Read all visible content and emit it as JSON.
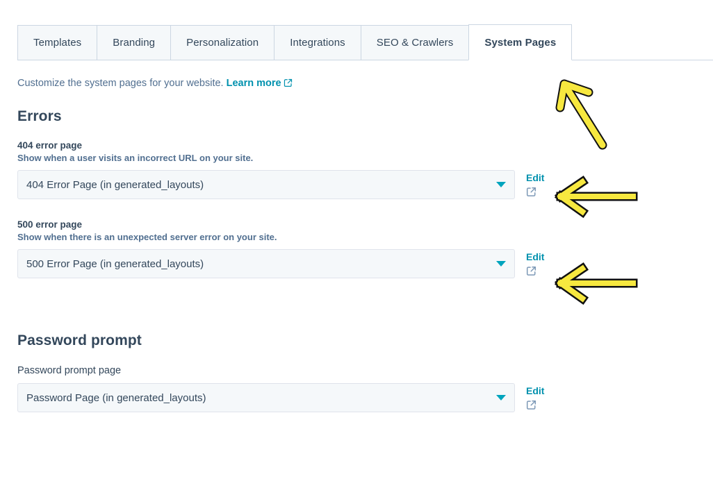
{
  "tabs": [
    {
      "label": "Templates",
      "active": false
    },
    {
      "label": "Branding",
      "active": false
    },
    {
      "label": "Personalization",
      "active": false
    },
    {
      "label": "Integrations",
      "active": false
    },
    {
      "label": "SEO & Crawlers",
      "active": false
    },
    {
      "label": "System Pages",
      "active": true
    }
  ],
  "intro": {
    "text": "Customize the system pages for your website.",
    "link_label": "Learn more",
    "link_icon": "external-link-icon"
  },
  "sections": [
    {
      "title": "Errors",
      "fields": [
        {
          "label": "404 error page",
          "label_bold": true,
          "help": "Show when a user visits an incorrect URL on your site.",
          "value": "404 Error Page (in generated_layouts)",
          "edit_label": "Edit",
          "caret_icon": "chevron-down-icon",
          "edit_icon": "external-link-icon"
        },
        {
          "label": "500 error page",
          "label_bold": true,
          "help": "Show when there is an unexpected server error on your site.",
          "value": "500 Error Page (in generated_layouts)",
          "edit_label": "Edit",
          "caret_icon": "chevron-down-icon",
          "edit_icon": "external-link-icon"
        }
      ]
    },
    {
      "title": "Password prompt",
      "fields": [
        {
          "label": "Password prompt page",
          "label_bold": false,
          "help": "",
          "value": "Password Page (in generated_layouts)",
          "edit_label": "Edit",
          "caret_icon": "chevron-down-icon",
          "edit_icon": "external-link-icon"
        }
      ]
    }
  ],
  "annotations": [
    {
      "name": "arrow-to-system-pages-tab",
      "direction": "up-left"
    },
    {
      "name": "arrow-to-404-edit",
      "direction": "left"
    },
    {
      "name": "arrow-to-500-edit",
      "direction": "left"
    }
  ],
  "colors": {
    "accent_teal": "#0091ae",
    "caret_teal": "#00a4bd",
    "text_dark": "#33475b",
    "text_muted": "#516f90",
    "border": "#cbd6e2",
    "field_bg": "#f5f8fa",
    "annotation_yellow": "#f7e83f"
  }
}
